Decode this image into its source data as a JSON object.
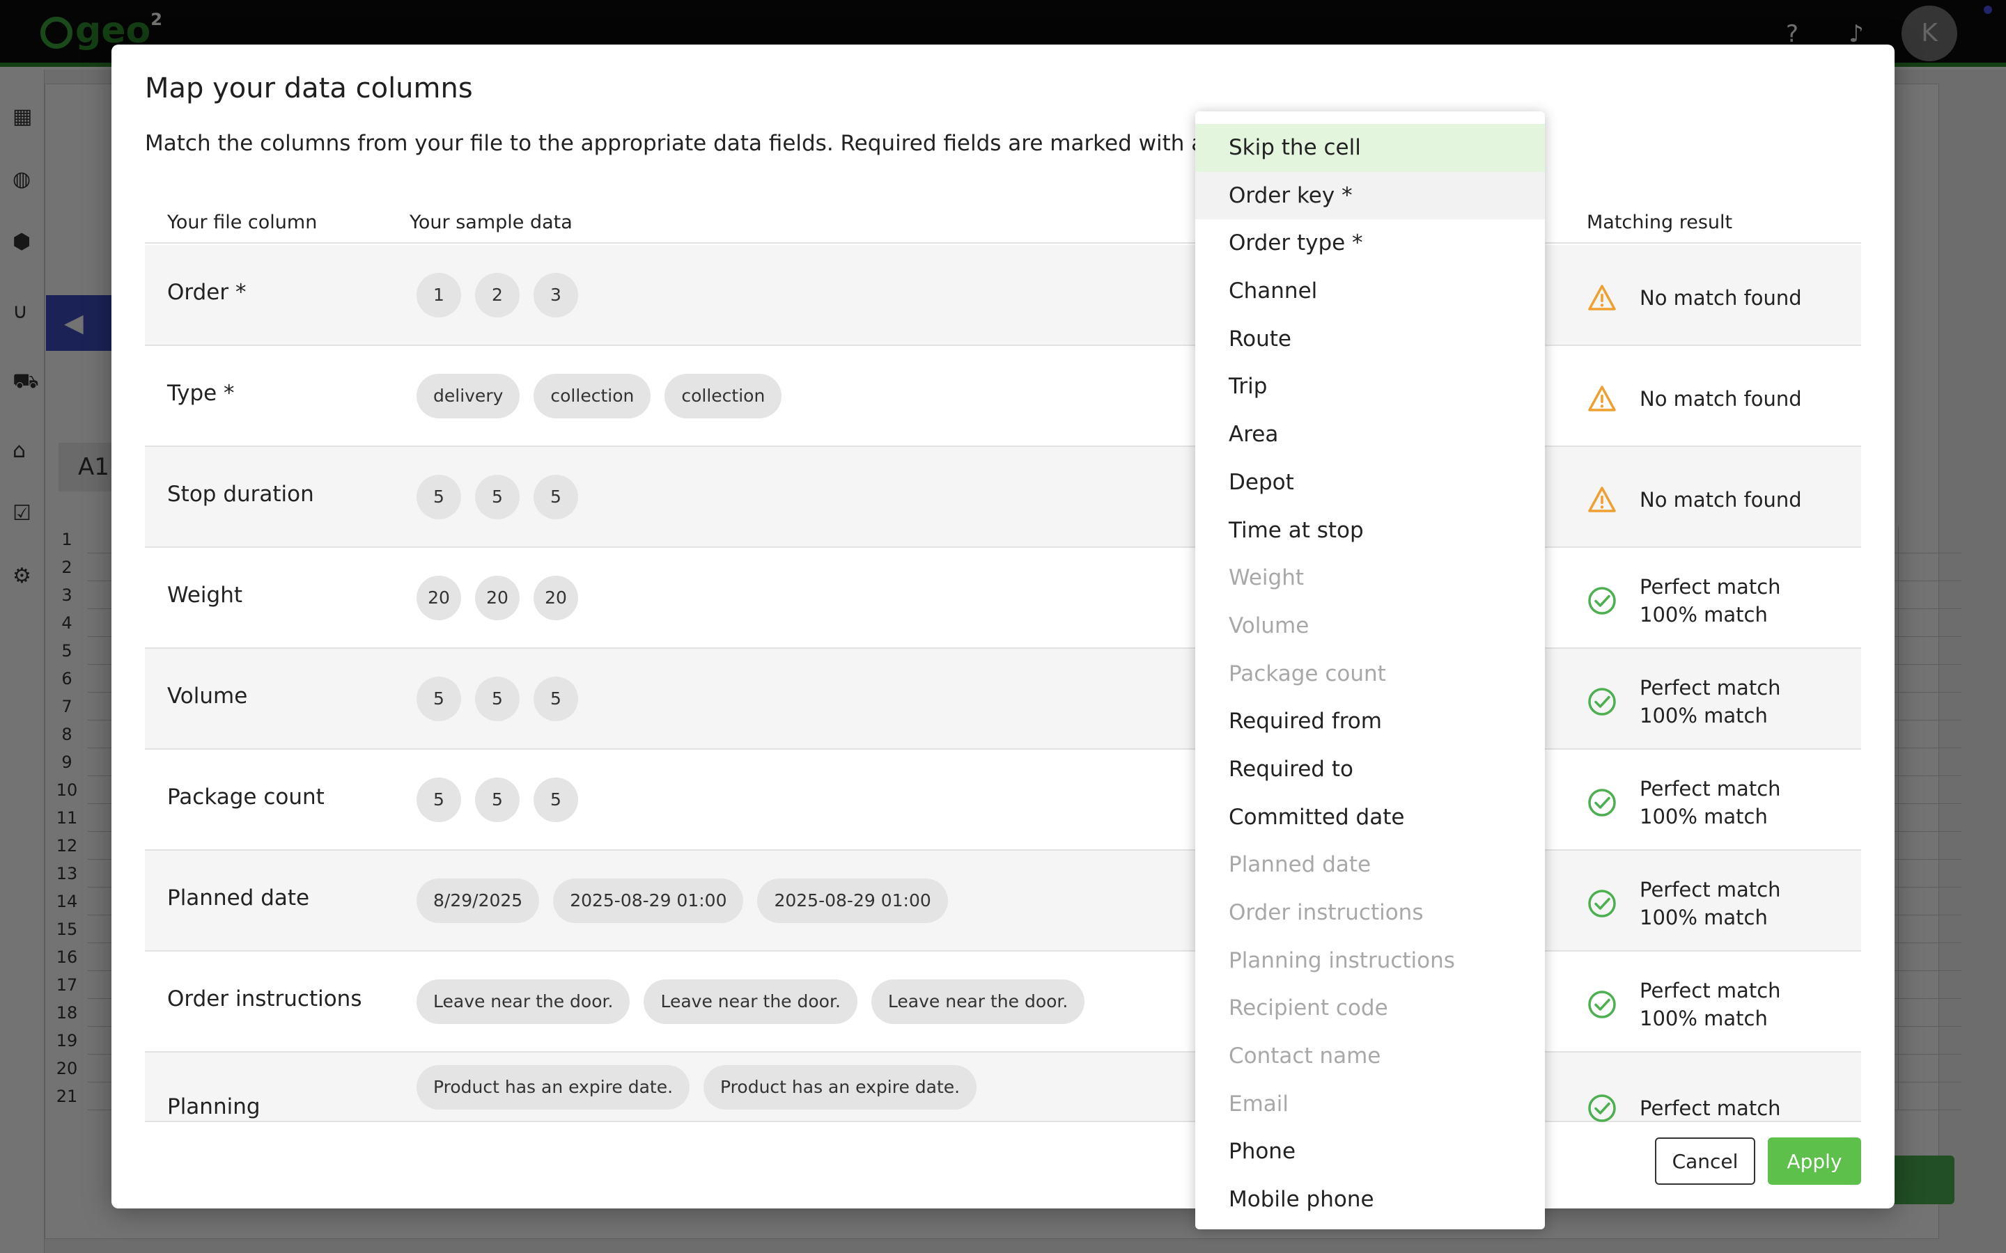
{
  "app": {
    "logo_text": "geo",
    "logo_sub": "2",
    "avatar_initial": "K",
    "sheet_cell": "A1",
    "row_numbers": [
      "1",
      "2",
      "3",
      "4",
      "5",
      "6",
      "7",
      "8",
      "9",
      "10",
      "11",
      "12",
      "13",
      "14",
      "15",
      "16",
      "17",
      "18",
      "19",
      "20",
      "21"
    ]
  },
  "modal": {
    "title": "Map your data columns",
    "description": "Match the columns from your file to the appropriate data fields. Required fields are marked with an asterisk",
    "headers": {
      "file_column": "Your file column",
      "sample_data": "Your sample data",
      "matching_result": "Matching result"
    },
    "rows": [
      {
        "name": "Order *",
        "samples": [
          "1",
          "2",
          "3"
        ],
        "status": "warning",
        "result_line1": "No match found",
        "result_line2": ""
      },
      {
        "name": "Type *",
        "samples": [
          "delivery",
          "collection",
          "collection"
        ],
        "status": "warning",
        "result_line1": "No match found",
        "result_line2": ""
      },
      {
        "name": "Stop duration",
        "samples": [
          "5",
          "5",
          "5"
        ],
        "status": "warning",
        "result_line1": "No match found",
        "result_line2": ""
      },
      {
        "name": "Weight",
        "samples": [
          "20",
          "20",
          "20"
        ],
        "status": "success",
        "result_line1": "Perfect match",
        "result_line2": "100% match"
      },
      {
        "name": "Volume",
        "samples": [
          "5",
          "5",
          "5"
        ],
        "status": "success",
        "result_line1": "Perfect match",
        "result_line2": "100% match"
      },
      {
        "name": "Package count",
        "samples": [
          "5",
          "5",
          "5"
        ],
        "status": "success",
        "result_line1": "Perfect match",
        "result_line2": "100% match"
      },
      {
        "name": "Planned date",
        "samples": [
          "8/29/2025",
          "2025-08-29 01:00",
          "2025-08-29 01:00"
        ],
        "status": "success",
        "result_line1": "Perfect match",
        "result_line2": "100% match"
      },
      {
        "name": "Order instructions",
        "samples": [
          "Leave near the door.",
          "Leave near the door.",
          "Leave near the door."
        ],
        "status": "success",
        "result_line1": "Perfect match",
        "result_line2": "100% match"
      },
      {
        "name": "Planning",
        "samples": [
          "Product has an expire date.",
          "Product has an expire date."
        ],
        "status": "success",
        "result_line1": "Perfect match",
        "result_line2": ""
      }
    ],
    "cancel_label": "Cancel",
    "apply_label": "Apply"
  },
  "dropdown": {
    "items": [
      {
        "label": "Skip the cell",
        "state": "selected"
      },
      {
        "label": "Order key *",
        "state": "hover"
      },
      {
        "label": "Order type *",
        "state": "enabled"
      },
      {
        "label": "Channel",
        "state": "enabled"
      },
      {
        "label": "Route",
        "state": "enabled"
      },
      {
        "label": "Trip",
        "state": "enabled"
      },
      {
        "label": "Area",
        "state": "enabled"
      },
      {
        "label": "Depot",
        "state": "enabled"
      },
      {
        "label": "Time at stop",
        "state": "enabled"
      },
      {
        "label": "Weight",
        "state": "disabled"
      },
      {
        "label": "Volume",
        "state": "disabled"
      },
      {
        "label": "Package count",
        "state": "disabled"
      },
      {
        "label": "Required from",
        "state": "enabled"
      },
      {
        "label": "Required to",
        "state": "enabled"
      },
      {
        "label": "Committed date",
        "state": "enabled"
      },
      {
        "label": "Planned date",
        "state": "disabled"
      },
      {
        "label": "Order instructions",
        "state": "disabled"
      },
      {
        "label": "Planning instructions",
        "state": "disabled"
      },
      {
        "label": "Recipient code",
        "state": "disabled"
      },
      {
        "label": "Contact name",
        "state": "disabled"
      },
      {
        "label": "Email",
        "state": "disabled"
      },
      {
        "label": "Phone",
        "state": "enabled"
      },
      {
        "label": "Mobile phone",
        "state": "enabled"
      }
    ]
  },
  "colors": {
    "accent_green": "#5cc04a",
    "warning_orange": "#f0a030",
    "success_green": "#4caf50",
    "selected_bg": "#e3f6dd"
  },
  "icons": {
    "warning": "warning-triangle-icon",
    "success": "check-circle-icon"
  }
}
